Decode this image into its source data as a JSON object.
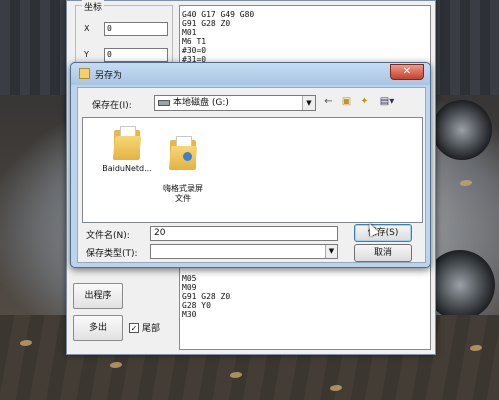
{
  "app": {
    "coord_group_title": "坐标",
    "x_label": "X",
    "x_value": "0",
    "y_label": "Y",
    "y_value": "0",
    "code_top": [
      "G40 G17 G49 G80",
      "G91 G28 Z0",
      "M01",
      "M6 T1",
      "#30=0",
      "#31=0"
    ],
    "code_bottom": [
      "M05",
      "M09",
      "G91 G28 Z0",
      "G28 Y0",
      "M30"
    ],
    "btn_output": "出程序",
    "btn_exit": "多出",
    "tail_label": "尾部",
    "tail_checked": true
  },
  "dialog": {
    "title": "另存为",
    "close_glyph": "✕",
    "save_in_label": "保存在(I):",
    "location": "本地磁盘 (G:)",
    "files": [
      {
        "name": "BaiduNetd...",
        "icon": "folder-icon"
      },
      {
        "name": "嗨格式录屏\n文件",
        "icon": "folder-app-icon"
      }
    ],
    "filename_label": "文件名(N):",
    "filename_value": "20",
    "filetype_label": "保存类型(T):",
    "filetype_value": "",
    "save_button": "保存(S)",
    "cancel_button": "取消"
  }
}
